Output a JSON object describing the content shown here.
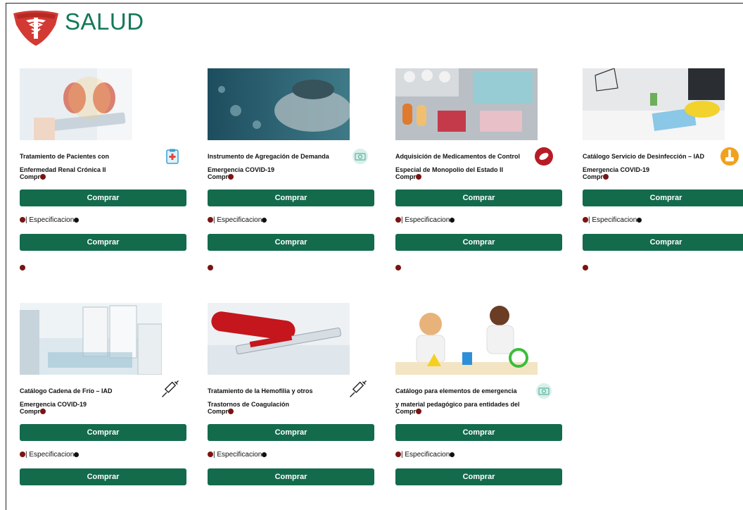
{
  "brand": {
    "name": "SALUD"
  },
  "colors": {
    "accent": "#136b4c",
    "brand_text": "#127a53",
    "logo_red": "#d23a33"
  },
  "cards": [
    {
      "title1": "Tratamiento de Pacientes con",
      "title2": "Enfermedad Renal Crónica II",
      "compra_label": "Compr",
      "buy_label": "Comprar",
      "spec_label": "| Especificacion",
      "buy2_label": "Comprar",
      "badge": "clipboard-medical-icon"
    },
    {
      "title1": "Instrumento de Agregación de Demanda",
      "title2": "Emergencia COVID-19",
      "compra_label": "Compr",
      "buy_label": "Comprar",
      "spec_label": "| Especificacion",
      "buy2_label": "Comprar",
      "badge": "camera-icon"
    },
    {
      "title1": "Adquisición de Medicamentos de Control",
      "title2": "Especial de Monopolio del Estado II",
      "compra_label": "Compr",
      "buy_label": "Comprar",
      "spec_label": "| Especificacion",
      "buy2_label": "Comprar",
      "badge": "pill-icon"
    },
    {
      "title1": "Catálogo Servicio de Desinfección – IAD",
      "title2": "Emergencia COVID-19",
      "compra_label": "Compr",
      "buy_label": "Comprar",
      "spec_label": "| Especificacion",
      "buy2_label": "Comprar",
      "badge": "cleaning-icon"
    },
    {
      "title1": "Catálogo Cadena de Frío – IAD",
      "title2": "Emergencia COVID-19",
      "compra_label": "Compr",
      "buy_label": "Comprar",
      "spec_label": "| Especificacion",
      "buy2_label": "Comprar",
      "badge": "syringe-icon"
    },
    {
      "title1": "Tratamiento de la Hemofilia y otros",
      "title2": "Trastornos de Coagulación",
      "compra_label": "Compr",
      "buy_label": "Comprar",
      "spec_label": "| Especificacion",
      "buy2_label": "Comprar",
      "badge": "syringe-icon"
    },
    {
      "title1": "Catálogo para elementos de emergencia",
      "title2": "y material pedagógico para entidades del",
      "compra_label": "Compr",
      "buy_label": "Comprar",
      "spec_label": "| Especificacion",
      "buy2_label": "Comprar",
      "badge": "camera-icon"
    }
  ]
}
